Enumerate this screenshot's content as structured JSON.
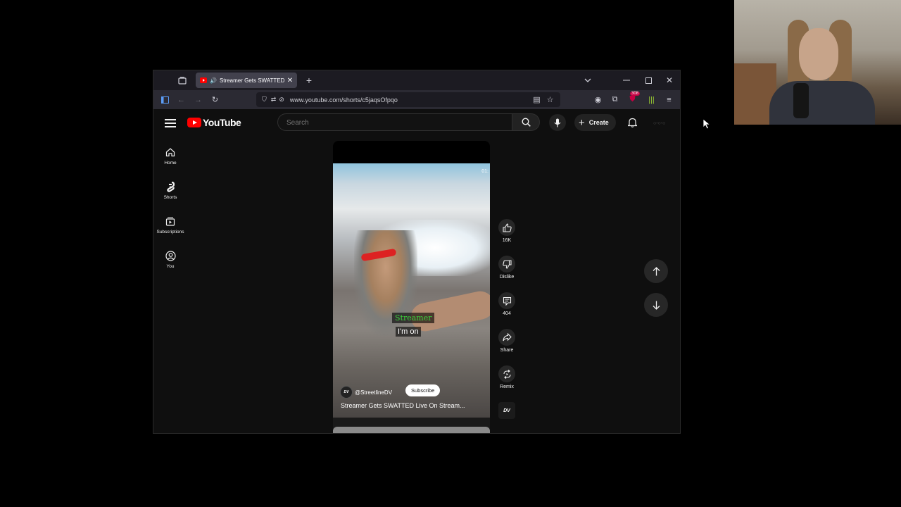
{
  "browser": {
    "tab_title": "Streamer Gets SWATTED Li",
    "url": "www.youtube.com/shorts/c5jaqsOfpqo",
    "extension_badge": "308"
  },
  "youtube": {
    "logo_text": "YouTube",
    "search_placeholder": "Search",
    "create_label": "Create",
    "sidebar": [
      {
        "label": "Home",
        "icon": "home-icon"
      },
      {
        "label": "Shorts",
        "icon": "shorts-icon"
      },
      {
        "label": "Subscriptions",
        "icon": "subscriptions-icon"
      },
      {
        "label": "You",
        "icon": "you-icon"
      }
    ],
    "short": {
      "caption_line1": "Streamer",
      "caption_line2": "I'm on",
      "timecode": "01:",
      "channel": "@StreetlineDV",
      "channel_logo": "DV",
      "subscribe_label": "Subscribe",
      "title": "Streamer Gets SWATTED Live On Stream..."
    },
    "actions": {
      "like_count": "16K",
      "dislike_label": "Dislike",
      "comment_count": "404",
      "share_label": "Share",
      "remix_label": "Remix"
    }
  },
  "colors": {
    "youtube_red": "#ff0000",
    "caption_green": "#3cd13c",
    "page_bg": "#0f0f0f"
  }
}
